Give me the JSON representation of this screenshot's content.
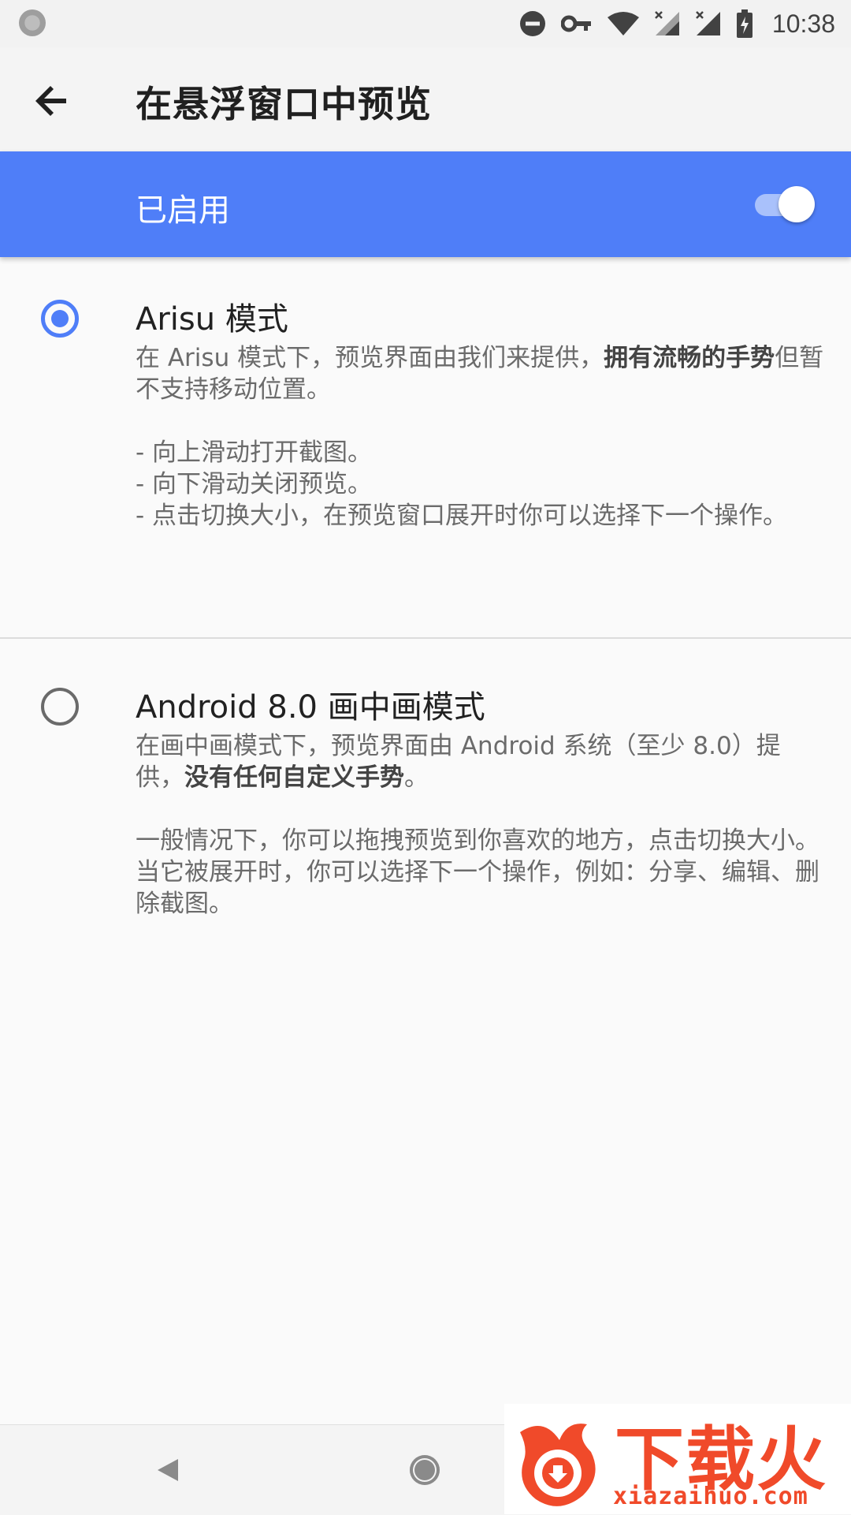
{
  "status_bar": {
    "time": "10:38",
    "icons": [
      "notification-dot-icon",
      "do-not-disturb-icon",
      "vpn-key-icon",
      "wifi-icon",
      "signal-1-icon",
      "signal-2-icon",
      "battery-charging-icon"
    ]
  },
  "app_bar": {
    "title": "在悬浮窗口中预览",
    "back_icon": "arrow-back-icon"
  },
  "master_switch": {
    "label": "已启用",
    "checked": true,
    "color": "#4f7ef8"
  },
  "options": [
    {
      "title": "Arisu 模式",
      "selected": true,
      "desc_part1": "在 Arisu 模式下，预览界面由我们来提供，",
      "desc_bold": "拥有流畅的手势",
      "desc_part2": "但暂不支持移动位置。",
      "list": [
        "- 向上滑动打开截图。",
        "- 向下滑动关闭预览。",
        "- 点击切换大小，在预览窗口展开时你可以选择下一个操作。"
      ]
    },
    {
      "title": "Android 8.0 画中画模式",
      "selected": false,
      "desc_part1": "在画中画模式下，预览界面由 Android 系统（至少 8.0）提供，",
      "desc_bold": "没有任何自定义手势",
      "desc_part2": "。",
      "paragraph": "一般情况下，你可以拖拽预览到你喜欢的地方，点击切换大小。当它被展开时，你可以选择下一个操作，例如：分享、编辑、删除截图。"
    }
  ],
  "nav_bar": {
    "back_icon": "nav-back-icon",
    "home_icon": "nav-home-icon"
  },
  "watermark": {
    "brand": "下载火",
    "url": "xiazaihuo.com"
  }
}
